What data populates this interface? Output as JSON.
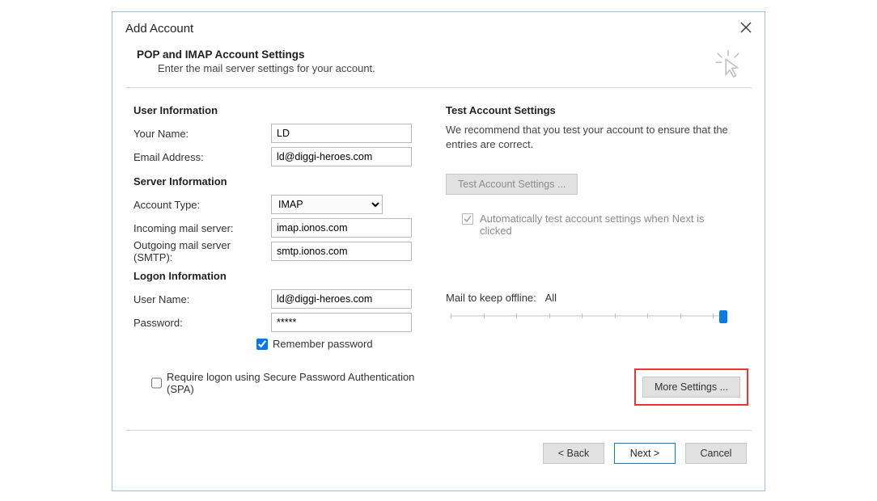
{
  "window": {
    "title": "Add Account"
  },
  "header": {
    "title": "POP and IMAP Account Settings",
    "subtitle": "Enter the mail server settings for your account."
  },
  "sections": {
    "user_info": "User Information",
    "server_info": "Server Information",
    "logon_info": "Logon Information",
    "test": "Test Account Settings"
  },
  "labels": {
    "your_name": "Your Name:",
    "email": "Email Address:",
    "account_type": "Account Type:",
    "incoming": "Incoming mail server:",
    "outgoing": "Outgoing mail server (SMTP):",
    "user_name": "User Name:",
    "password": "Password:",
    "remember": "Remember password",
    "spa": "Require logon using Secure Password Authentication (SPA)",
    "test_desc": "We recommend that you test your account to ensure that the entries are correct.",
    "test_btn": "Test Account Settings ...",
    "auto_test": "Automatically test account settings when Next is clicked",
    "mail_offline": "Mail to keep offline:",
    "mail_offline_value": "All",
    "more_settings": "More Settings ..."
  },
  "values": {
    "your_name": "LD",
    "email": "ld@diggi-heroes.com",
    "account_type": "IMAP",
    "incoming": "imap.ionos.com",
    "outgoing": "smtp.ionos.com",
    "user_name": "ld@diggi-heroes.com",
    "password": "*****",
    "remember_checked": true,
    "spa_checked": false,
    "auto_test_checked": true
  },
  "footer": {
    "back": "< Back",
    "next": "Next >",
    "cancel": "Cancel"
  }
}
